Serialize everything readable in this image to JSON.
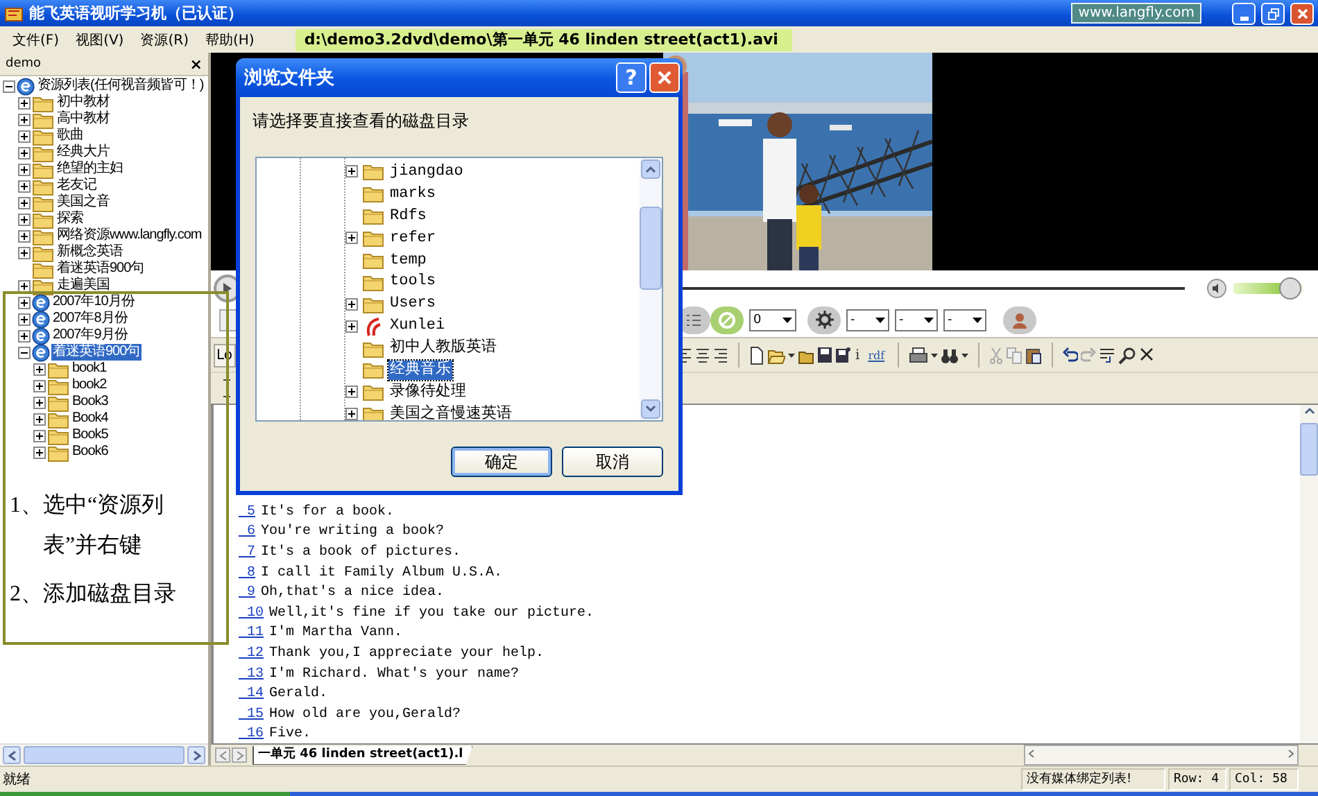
{
  "window": {
    "title": "能飞英语视听学习机（已认证）",
    "website_badge": "www.langfly.com"
  },
  "menu": [
    {
      "label": "文件(F)"
    },
    {
      "label": "视图(V)"
    },
    {
      "label": "资源(R)"
    },
    {
      "label": "帮助(H)"
    }
  ],
  "current_file": "d:\\demo3.2dvd\\demo\\第一单元 46 linden street(act1).avi",
  "resource_panel": {
    "title": "demo",
    "close": "×",
    "tree": [
      {
        "label": "资源列表(任何视音频皆可！)",
        "kind": "resource",
        "has_toggle": true,
        "selected": false,
        "children": [
          {
            "label": "初中教材",
            "kind": "folder",
            "has_toggle": true,
            "selected": false
          },
          {
            "label": "高中教材",
            "kind": "folder",
            "has_toggle": true,
            "selected": false
          },
          {
            "label": "歌曲",
            "kind": "folder",
            "has_toggle": true,
            "selected": false
          },
          {
            "label": "经典大片",
            "kind": "folder",
            "has_toggle": true,
            "selected": false
          },
          {
            "label": "绝望的主妇",
            "kind": "folder",
            "has_toggle": true,
            "selected": false
          },
          {
            "label": "老友记",
            "kind": "folder",
            "has_toggle": true,
            "selected": false
          },
          {
            "label": "美国之音",
            "kind": "folder",
            "has_toggle": true,
            "selected": false
          },
          {
            "label": "探索",
            "kind": "folder",
            "has_toggle": true,
            "selected": false
          },
          {
            "label": "网络资源www.langfly.com",
            "kind": "folder",
            "has_toggle": true,
            "selected": false
          },
          {
            "label": "新概念英语",
            "kind": "folder",
            "has_toggle": true,
            "selected": false
          },
          {
            "label": "着迷英语900句",
            "kind": "folder",
            "has_toggle": false,
            "selected": false
          },
          {
            "label": "走遍美国",
            "kind": "folder",
            "has_toggle": true,
            "selected": false
          },
          {
            "label": "2007年10月份",
            "kind": "resource",
            "has_toggle": true,
            "selected": false
          },
          {
            "label": "2007年8月份",
            "kind": "resource",
            "has_toggle": true,
            "selected": false
          },
          {
            "label": "2007年9月份",
            "kind": "resource",
            "has_toggle": true,
            "selected": false
          },
          {
            "label": "着迷英语900句",
            "kind": "resource",
            "has_toggle": true,
            "selected": true,
            "children": [
              {
                "label": "book1",
                "kind": "folder",
                "has_toggle": true,
                "selected": false
              },
              {
                "label": "book2",
                "kind": "folder",
                "has_toggle": true,
                "selected": false
              },
              {
                "label": "Book3",
                "kind": "folder",
                "has_toggle": true,
                "selected": false
              },
              {
                "label": "Book4",
                "kind": "folder",
                "has_toggle": true,
                "selected": false
              },
              {
                "label": "Book5",
                "kind": "folder",
                "has_toggle": true,
                "selected": false
              },
              {
                "label": "Book6",
                "kind": "folder",
                "has_toggle": true,
                "selected": false
              }
            ]
          }
        ]
      }
    ]
  },
  "annotation": {
    "steps": [
      {
        "number": "1、",
        "text": "选中“资源列表”并右键"
      },
      {
        "number": "2、",
        "text": "添加磁盘目录"
      }
    ]
  },
  "player": {
    "dropdowns": [
      {
        "value": "0"
      },
      {
        "value": "-"
      },
      {
        "value": "-"
      },
      {
        "value": "-"
      }
    ],
    "volume": {
      "level": 0.8
    }
  },
  "editor_toolbar": {
    "left_label": "Lo",
    "info_label": "i",
    "rdf_label": "rdf"
  },
  "transcript": [
    {
      "number": "5",
      "text": "It's for a book."
    },
    {
      "number": "6",
      "text": "You're writing a book?"
    },
    {
      "number": "7",
      "text": "It's a book of pictures."
    },
    {
      "number": "8",
      "text": "I call it Family Album U.S.A."
    },
    {
      "number": "9",
      "text": "Oh,that's a nice idea."
    },
    {
      "number": "10",
      "text": "Well,it's fine if you take our picture."
    },
    {
      "number": "11",
      "text": "I'm Martha Vann."
    },
    {
      "number": "12",
      "text": "Thank you,I appreciate your help."
    },
    {
      "number": "13",
      "text": "I'm Richard. What's your name?"
    },
    {
      "number": "14",
      "text": "Gerald."
    },
    {
      "number": "15",
      "text": "How old are you,Gerald?"
    },
    {
      "number": "16",
      "text": "Five."
    }
  ],
  "document_tab": {
    "label": "一单元 46 linden street(act1).l",
    "selected": true
  },
  "status_bar": {
    "text": "就绪",
    "media_list": "没有媒体绑定列表!",
    "row": "Row: 4",
    "col": "Col: 58"
  },
  "dialog": {
    "title": "浏览文件夹",
    "help": "?",
    "prompt": "请选择要直接查看的磁盘目录",
    "folders": [
      {
        "label": "jiangdao",
        "kind": "folder",
        "expandable": true,
        "selected": false
      },
      {
        "label": "marks",
        "kind": "folder",
        "expandable": false,
        "selected": false
      },
      {
        "label": "Rdfs",
        "kind": "folder",
        "expandable": false,
        "selected": false
      },
      {
        "label": "refer",
        "kind": "folder",
        "expandable": true,
        "selected": false
      },
      {
        "label": "temp",
        "kind": "folder",
        "expandable": false,
        "selected": false
      },
      {
        "label": "tools",
        "kind": "folder",
        "expandable": false,
        "selected": false
      },
      {
        "label": "Users",
        "kind": "folder",
        "expandable": true,
        "selected": false
      },
      {
        "label": "Xunlei",
        "kind": "app",
        "expandable": true,
        "selected": false
      },
      {
        "label": "初中人教版英语",
        "kind": "folder",
        "expandable": false,
        "selected": false
      },
      {
        "label": "经典音乐",
        "kind": "folder",
        "expandable": false,
        "selected": true
      },
      {
        "label": "录像待处理",
        "kind": "folder",
        "expandable": true,
        "selected": false
      },
      {
        "label": "美国之音慢速英语",
        "kind": "folder",
        "expandable": true,
        "selected": false
      }
    ],
    "buttons": [
      {
        "label": "确定",
        "default": true
      },
      {
        "label": "取消",
        "default": false
      }
    ]
  }
}
